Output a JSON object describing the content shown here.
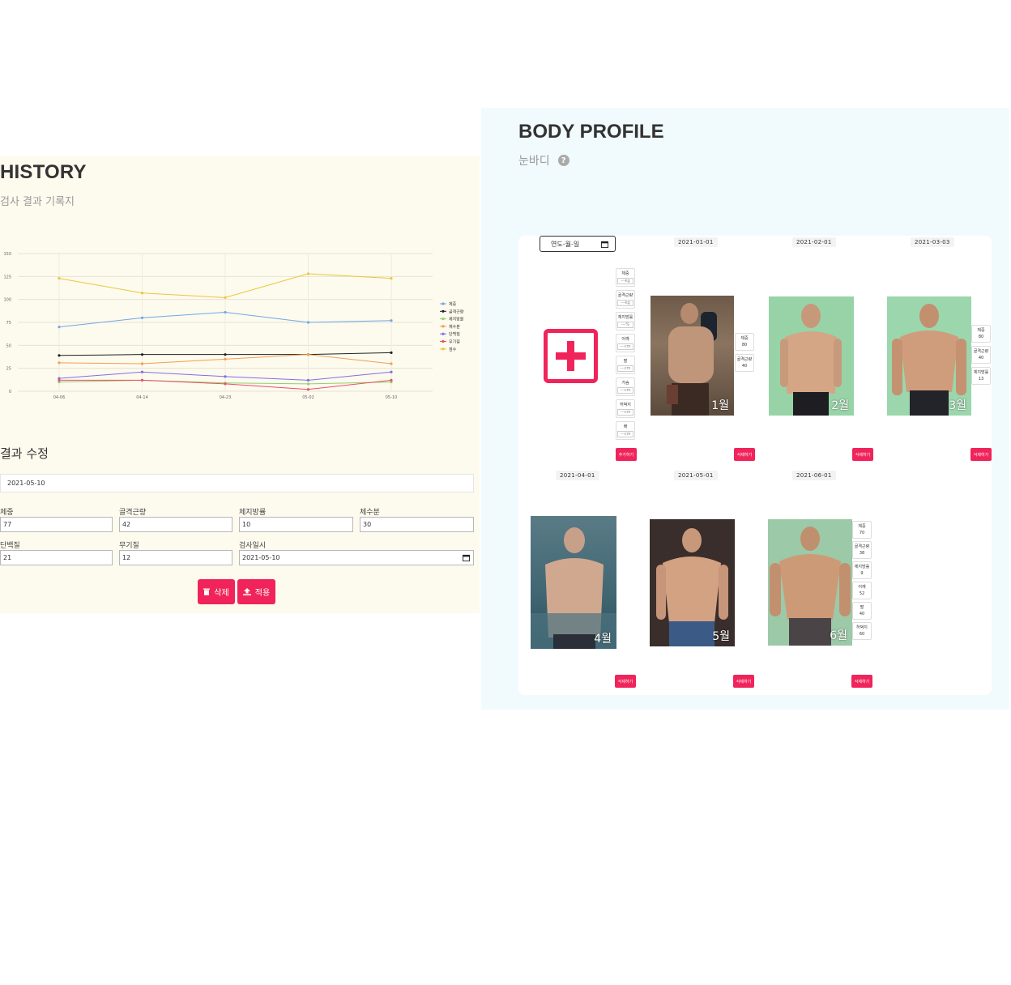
{
  "history": {
    "title": "HISTORY",
    "subtitle": "검사 결과 기록지",
    "edit_title": "결과 수정",
    "selected_date": "2021-05-10",
    "fields": [
      {
        "label": "체중",
        "value": "77"
      },
      {
        "label": "골격근량",
        "value": "42"
      },
      {
        "label": "체지방률",
        "value": "10"
      },
      {
        "label": "체수분",
        "value": "30"
      },
      {
        "label": "단백질",
        "value": "21"
      },
      {
        "label": "무기질",
        "value": "12"
      },
      {
        "label": "검사일시",
        "value": "2021-05-10"
      }
    ],
    "delete_label": "삭제",
    "apply_label": "적용"
  },
  "chart_data": {
    "type": "line",
    "categories": [
      "04-06",
      "04-14",
      "04-23",
      "05-02",
      "05-10"
    ],
    "y_ticks": [
      "0",
      "25",
      "50",
      "75",
      "100",
      "125",
      "150"
    ],
    "ylim": [
      0,
      150
    ],
    "grid": true,
    "legend_position": "right",
    "series": [
      {
        "name": "체중",
        "color": "#6fa8e6",
        "values": [
          70,
          80,
          86,
          75,
          77
        ]
      },
      {
        "name": "골격근량",
        "color": "#222222",
        "values": [
          39,
          40,
          40,
          40,
          42
        ]
      },
      {
        "name": "체지방률",
        "color": "#8fd16e",
        "values": [
          10,
          12,
          9,
          8,
          10
        ]
      },
      {
        "name": "체수분",
        "color": "#f0a050",
        "values": [
          31,
          30,
          35,
          40,
          30
        ]
      },
      {
        "name": "단백질",
        "color": "#7f6fe8",
        "values": [
          14,
          21,
          16,
          12,
          21
        ]
      },
      {
        "name": "무기질",
        "color": "#e8506a",
        "values": [
          12,
          12,
          8,
          2,
          12
        ]
      },
      {
        "name": "점수",
        "color": "#e8c83a",
        "values": [
          123,
          107,
          102,
          128,
          123
        ]
      }
    ]
  },
  "profile": {
    "title": "BODY PROFILE",
    "subtitle": "눈바디",
    "date_placeholder": "연도-월-일",
    "add_button_label": "추가하기",
    "delete_button_label": "삭제하기",
    "new_entry_fields": [
      {
        "label": "체중",
        "unit": "---kg"
      },
      {
        "label": "골격근량",
        "unit": "---kg"
      },
      {
        "label": "체지방률",
        "unit": "---%"
      },
      {
        "label": "어깨",
        "unit": "---cm"
      },
      {
        "label": "팔",
        "unit": "---cm"
      },
      {
        "label": "가슴",
        "unit": "---cm"
      },
      {
        "label": "허벅지",
        "unit": "---cm"
      },
      {
        "label": "배",
        "unit": "---cm"
      }
    ],
    "entries": [
      {
        "date": "2021-01-01",
        "month": "1월",
        "stats": [
          {
            "label": "체중",
            "value": "80"
          },
          {
            "label": "골격근량",
            "value": "40"
          }
        ]
      },
      {
        "date": "2021-02-01",
        "month": "2월",
        "stats": []
      },
      {
        "date": "2021-03-03",
        "month": "3월",
        "stats": [
          {
            "label": "체중",
            "value": "80"
          },
          {
            "label": "골격근량",
            "value": "40"
          },
          {
            "label": "체지방률",
            "value": "13"
          }
        ]
      },
      {
        "date": "2021-04-01",
        "month": "4월",
        "stats": []
      },
      {
        "date": "2021-05-01",
        "month": "5월",
        "stats": []
      },
      {
        "date": "2021-06-01",
        "month": "6월",
        "stats": [
          {
            "label": "체중",
            "value": "70"
          },
          {
            "label": "골격근량",
            "value": "38"
          },
          {
            "label": "체지방률",
            "value": "9"
          },
          {
            "label": "어깨",
            "value": "52"
          },
          {
            "label": "팔",
            "value": "40"
          },
          {
            "label": "허벅지",
            "value": "60"
          }
        ]
      }
    ]
  }
}
